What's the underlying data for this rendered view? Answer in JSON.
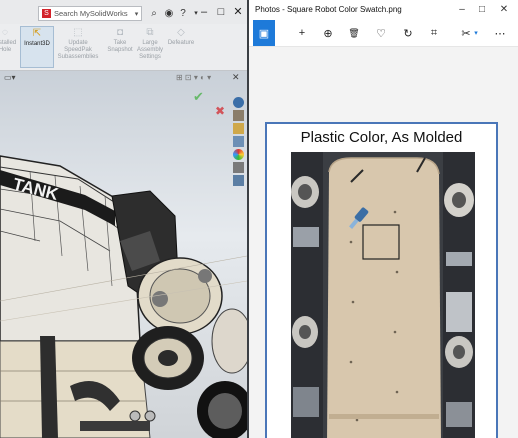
{
  "solidworks": {
    "search": {
      "badge": "S",
      "placeholder": "Search MySolidWorks"
    },
    "window_controls": {
      "minimize": "–",
      "maximize": "□",
      "close": "✕"
    },
    "ribbon": [
      {
        "label": "Installed Hole",
        "icon": "hole-icon",
        "state": "disabled"
      },
      {
        "label": "Instant3D",
        "icon": "instant3d-icon",
        "state": "active"
      },
      {
        "label": "Update SpeedPak Subassemblies",
        "icon": "speedpak-icon",
        "state": "disabled"
      },
      {
        "label": "Take Snapshot",
        "icon": "camera-icon",
        "state": "disabled"
      },
      {
        "label": "Large Assembly Settings",
        "icon": "large-assembly-icon",
        "state": "disabled"
      },
      {
        "label": "Defeature",
        "icon": "defeature-icon",
        "state": "disabled"
      }
    ],
    "model_text": "TANK",
    "confirm": {
      "accept": "✔",
      "cancel": "✖"
    }
  },
  "photos": {
    "title": "Photos - Square Robot Color Swatch.png",
    "window_controls": {
      "minimize": "–",
      "maximize": "□",
      "close": "✕"
    },
    "toolbar": [
      {
        "name": "slideshow",
        "glyph": "▣",
        "active": true
      },
      {
        "name": "add",
        "glyph": "+"
      },
      {
        "name": "zoom",
        "glyph": "⊕"
      },
      {
        "name": "delete",
        "glyph": "🗑"
      },
      {
        "name": "favorite",
        "glyph": "♡"
      },
      {
        "name": "rotate",
        "glyph": "↻"
      },
      {
        "name": "crop",
        "glyph": "⌗"
      },
      {
        "name": "edit-effects",
        "glyph": "✂"
      }
    ],
    "swatch": {
      "title": "Plastic Color, As Molded"
    }
  },
  "colors": {
    "photos_accent": "#1e7ad9",
    "swatch_border": "#4a76b8",
    "molded_plastic": "#d8c7ad",
    "sw_active_tool": "#d7e3ee"
  }
}
